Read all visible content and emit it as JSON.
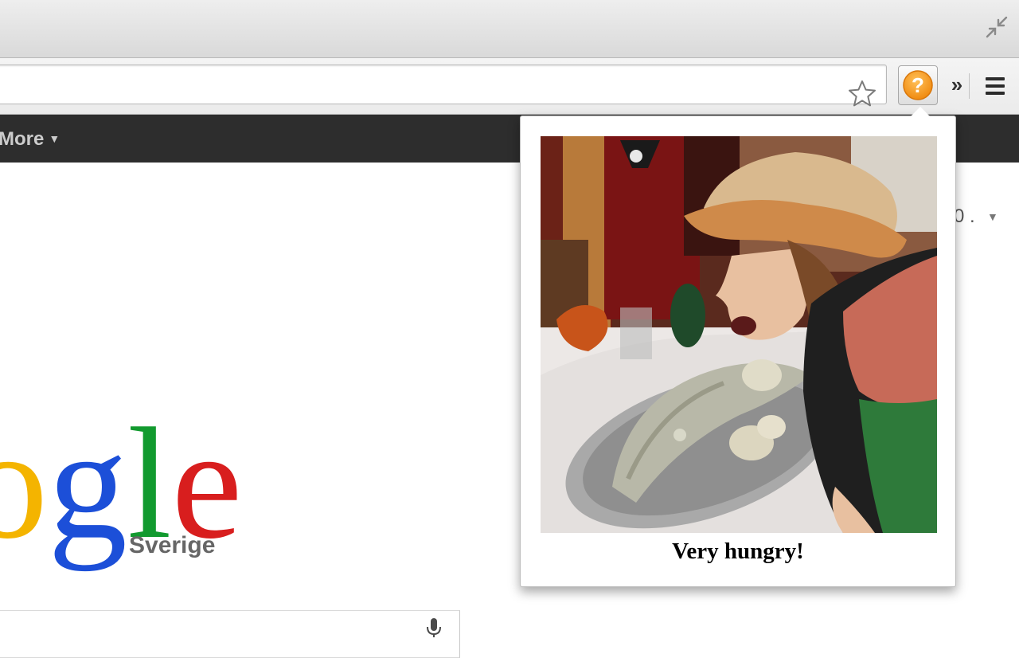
{
  "browser": {
    "icons": {
      "fullscreen": "fullscreen-exit-icon",
      "bookmark": "star-icon",
      "extension": "question-mark-icon",
      "overflow": "double-chevron-icon",
      "menu": "hamburger-menu-icon"
    },
    "overflow_label": "»"
  },
  "google_bar": {
    "more_label": "More",
    "more_caret": "▼"
  },
  "account": {
    "partial_text": "0 .",
    "caret": "▼"
  },
  "logo": {
    "letters": [
      {
        "char": "o",
        "color": "#f4b400"
      },
      {
        "char": "g",
        "color": "#1c4fd8"
      },
      {
        "char": "l",
        "color": "#129a2f"
      },
      {
        "char": "e",
        "color": "#d81e1e"
      }
    ],
    "subtitle": "Sverige"
  },
  "search": {
    "mic_icon": "microphone-icon"
  },
  "popup": {
    "photo_alt": "photo",
    "caption": "Very hungry!"
  },
  "colors": {
    "ext_orange": "#f7931e",
    "gbar": "#2d2d2d"
  }
}
